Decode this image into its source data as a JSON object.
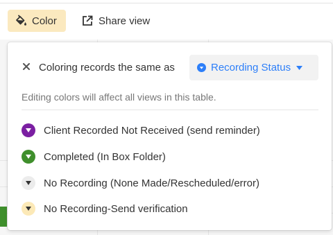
{
  "toolbar": {
    "color_label": "Color",
    "share_label": "Share view"
  },
  "popover": {
    "prefix": "Coloring records the same as",
    "field_name": "Recording Status",
    "hint": "Editing colors will affect all views in this table.",
    "options": [
      {
        "label": "Client Recorded Not Received (send reminder)",
        "color": "#7b1fa2",
        "arrow": "#ffffff"
      },
      {
        "label": "Completed (In Box Folder)",
        "color": "#3f8f2c",
        "arrow": "#ffffff"
      },
      {
        "label": "No Recording (None Made/Rescheduled/error)",
        "color": "#ececec",
        "arrow": "#333333"
      },
      {
        "label": "No Recording-Send verification",
        "color": "#fce9b7",
        "arrow": "#333333"
      }
    ]
  },
  "colors": {
    "accent_blue": "#2d7ff9",
    "color_button_bg": "#fbe9bf"
  },
  "icons": {
    "color_button": "paint-bucket-icon",
    "share_button": "external-link-icon",
    "close": "close-icon",
    "field": "single-select-field-icon",
    "dropdown": "caret-down-icon",
    "option": "caret-down-in-circle-icon"
  }
}
